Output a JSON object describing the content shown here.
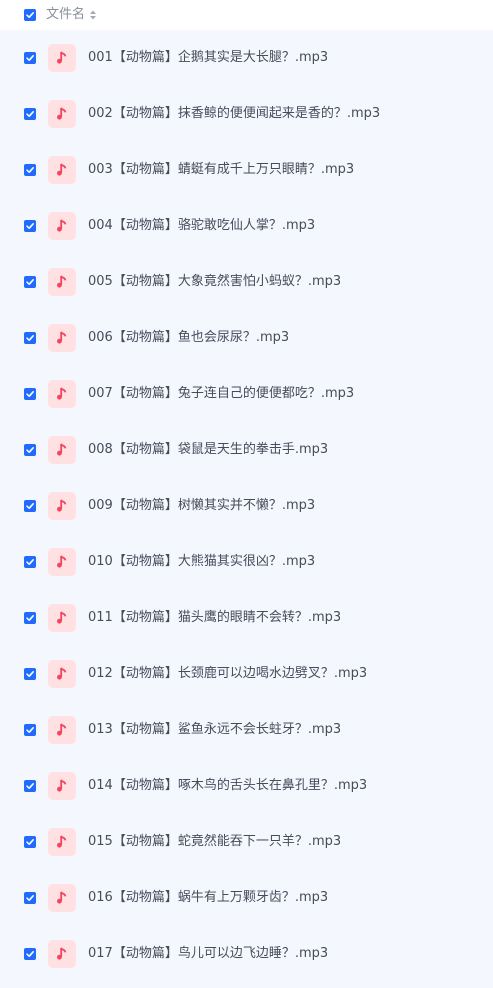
{
  "header": {
    "select_all_checked": true,
    "column_label": "文件名"
  },
  "files": [
    {
      "name": "001【动物篇】企鹅其实是大长腿？.mp3",
      "checked": true,
      "icon": "music-note-icon"
    },
    {
      "name": "002【动物篇】抹香鲸的便便闻起来是香的？.mp3",
      "checked": true,
      "icon": "music-note-icon"
    },
    {
      "name": "003【动物篇】蜻蜓有成千上万只眼睛？.mp3",
      "checked": true,
      "icon": "music-note-icon"
    },
    {
      "name": "004【动物篇】骆驼敢吃仙人掌？.mp3",
      "checked": true,
      "icon": "music-note-icon"
    },
    {
      "name": "005【动物篇】大象竟然害怕小蚂蚁？.mp3",
      "checked": true,
      "icon": "music-note-icon"
    },
    {
      "name": "006【动物篇】鱼也会尿尿？.mp3",
      "checked": true,
      "icon": "music-note-icon"
    },
    {
      "name": "007【动物篇】兔子连自己的便便都吃？.mp3",
      "checked": true,
      "icon": "music-note-icon"
    },
    {
      "name": "008【动物篇】袋鼠是天生的拳击手.mp3",
      "checked": true,
      "icon": "music-note-icon"
    },
    {
      "name": "009【动物篇】树懒其实并不懒？.mp3",
      "checked": true,
      "icon": "music-note-icon"
    },
    {
      "name": "010【动物篇】大熊猫其实很凶？.mp3",
      "checked": true,
      "icon": "music-note-icon"
    },
    {
      "name": "011【动物篇】猫头鹰的眼睛不会转？.mp3",
      "checked": true,
      "icon": "music-note-icon"
    },
    {
      "name": "012【动物篇】长颈鹿可以边喝水边劈叉？.mp3",
      "checked": true,
      "icon": "music-note-icon"
    },
    {
      "name": "013【动物篇】鲨鱼永远不会长蛀牙？.mp3",
      "checked": true,
      "icon": "music-note-icon"
    },
    {
      "name": "014【动物篇】啄木鸟的舌头长在鼻孔里？.mp3",
      "checked": true,
      "icon": "music-note-icon"
    },
    {
      "name": "015【动物篇】蛇竟然能吞下一只羊？.mp3",
      "checked": true,
      "icon": "music-note-icon"
    },
    {
      "name": "016【动物篇】蜗牛有上万颗牙齿？.mp3",
      "checked": true,
      "icon": "music-note-icon"
    },
    {
      "name": "017【动物篇】鸟儿可以边飞边睡？.mp3",
      "checked": true,
      "icon": "music-note-icon"
    }
  ],
  "colors": {
    "checkbox": "#1f6bff",
    "list_background": "#f5f7fe",
    "icon_background": "#ffe1e4",
    "icon_note": "#f6455a",
    "text": "#454d5a",
    "header_text": "#8a8f99"
  }
}
